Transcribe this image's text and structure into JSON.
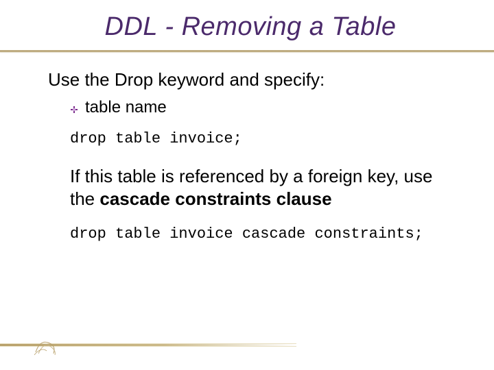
{
  "title": "DDL - Removing a Table",
  "intro": "Use the Drop keyword and specify:",
  "bullet1": "table name",
  "code1": "drop table invoice;",
  "para_pre": "If this table is referenced by a foreign key, use the ",
  "para_bold": "cascade constraints clause",
  "code2": "drop table invoice cascade constraints;"
}
